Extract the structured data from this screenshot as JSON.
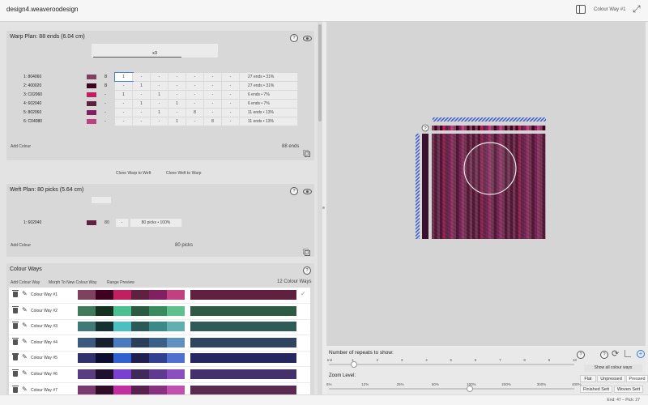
{
  "app": {
    "title": "design4.weaveroodesign",
    "colour_way_label": "Colour Way #1"
  },
  "warp": {
    "title": "Warp Plan:  88 ends (6.04 cm)",
    "repeat_label": "x3",
    "total": "88 ends",
    "add_colour": "Add Colour",
    "rows": [
      {
        "label": "1:  804060",
        "color": "#804060",
        "count": "8",
        "cells": [
          "1",
          "-",
          "-",
          "-",
          "-",
          "-",
          "-",
          "-"
        ],
        "summary": "27 ends  • 31%"
      },
      {
        "label": "2:  400020",
        "color": "#400020",
        "count": "8",
        "cells": [
          "-",
          "1",
          "-",
          "-",
          "-",
          "-",
          "-",
          "-"
        ],
        "summary": "27 ends  • 31%"
      },
      {
        "label": "3:  C02060",
        "color": "#C02060",
        "count": "-",
        "cells": [
          "1",
          "-",
          "1",
          "-",
          "-",
          "-",
          "-",
          "-"
        ],
        "summary": "6 ends  • 7%"
      },
      {
        "label": "4:  602040",
        "color": "#602040",
        "count": "-",
        "cells": [
          "-",
          "1",
          "-",
          "1",
          "-",
          "-",
          "-",
          "-"
        ],
        "summary": "6 ends  • 7%"
      },
      {
        "label": "5:  802060",
        "color": "#802060",
        "count": "-",
        "cells": [
          "-",
          "-",
          "1",
          "-",
          "8",
          "-",
          "-",
          "-"
        ],
        "summary": "11 ends  • 13%"
      },
      {
        "label": "6:  C04080",
        "color": "#C04080",
        "count": "-",
        "cells": [
          "-",
          "-",
          "-",
          "1",
          "-",
          "8",
          "-",
          "-"
        ],
        "summary": "11 ends  • 13%"
      }
    ]
  },
  "clone": {
    "warp_to_weft": "Clone Warp to Weft",
    "weft_to_warp": "Clone Weft to Warp"
  },
  "weft": {
    "title": "Weft Plan:  80 picks (5.64 cm)",
    "total": "80 picks",
    "add_colour": "Add Colour",
    "rows": [
      {
        "label": "1:  602040",
        "color": "#602040",
        "count": "80",
        "dash": "-",
        "summary": "80 picks  • 100%"
      }
    ]
  },
  "colour_ways": {
    "title": "Colour Ways",
    "add": "Add Colour Way",
    "morph": "Morph To New Colour Way",
    "range": "Range Preview",
    "count": "12 Colour Ways",
    "items": [
      {
        "name": "Colour Way #1",
        "swatches": [
          "#804060",
          "#400020",
          "#C02060",
          "#602040",
          "#802060",
          "#C04080"
        ],
        "weft": "#602040",
        "selected": true
      },
      {
        "name": "Colour Way #2",
        "swatches": [
          "#407a5a",
          "#14301f",
          "#4cc090",
          "#2a5a40",
          "#3a8a60",
          "#60c090"
        ],
        "weft": "#2e5a44",
        "selected": false
      },
      {
        "name": "Colour Way #3",
        "swatches": [
          "#407a78",
          "#143030",
          "#4cc0c0",
          "#2a5a58",
          "#3a8a88",
          "#60b0b0"
        ],
        "weft": "#2e5a58",
        "selected": false
      },
      {
        "name": "Colour Way #4",
        "swatches": [
          "#3c5a80",
          "#142030",
          "#4c7ac0",
          "#2a405a",
          "#3a608a",
          "#6090c0"
        ],
        "weft": "#2e4460",
        "selected": false
      },
      {
        "name": "Colour Way #5",
        "swatches": [
          "#30306a",
          "#0c0c30",
          "#3060d0",
          "#202050",
          "#304090",
          "#5070d0"
        ],
        "weft": "#262660",
        "selected": false
      },
      {
        "name": "Colour Way #6",
        "swatches": [
          "#5a3c80",
          "#201030",
          "#7a40d0",
          "#402a5a",
          "#603a90",
          "#8a50c0"
        ],
        "weft": "#44306a",
        "selected": false
      },
      {
        "name": "Colour Way #7",
        "swatches": [
          "#7a3c70",
          "#300c28",
          "#c030a0",
          "#5a2050",
          "#8a3080",
          "#c050b0"
        ],
        "weft": "#5a2a50",
        "selected": false
      }
    ]
  },
  "preview": {
    "help": "?"
  },
  "repeats": {
    "label": "Number of repeats to show:",
    "ticks": [
      "Init",
      "1",
      "2",
      "3",
      "4",
      "5",
      "6",
      "7",
      "8",
      "9",
      "10"
    ],
    "value_index": 1,
    "show_all": "Show all colour ways"
  },
  "zoom": {
    "label": "Zoom Level:",
    "ticks": [
      "6%",
      "12%",
      "25%",
      "50%",
      "100%",
      "200%",
      "300%",
      "400%"
    ],
    "value_index": 4,
    "modes": [
      "Flat",
      "Unpressed",
      "Pressed"
    ],
    "active_mode": "Pressed",
    "sett": [
      "Finished Sett",
      "Woven Sett"
    ]
  },
  "status": {
    "text": "End: 47 – Pick: 27"
  }
}
